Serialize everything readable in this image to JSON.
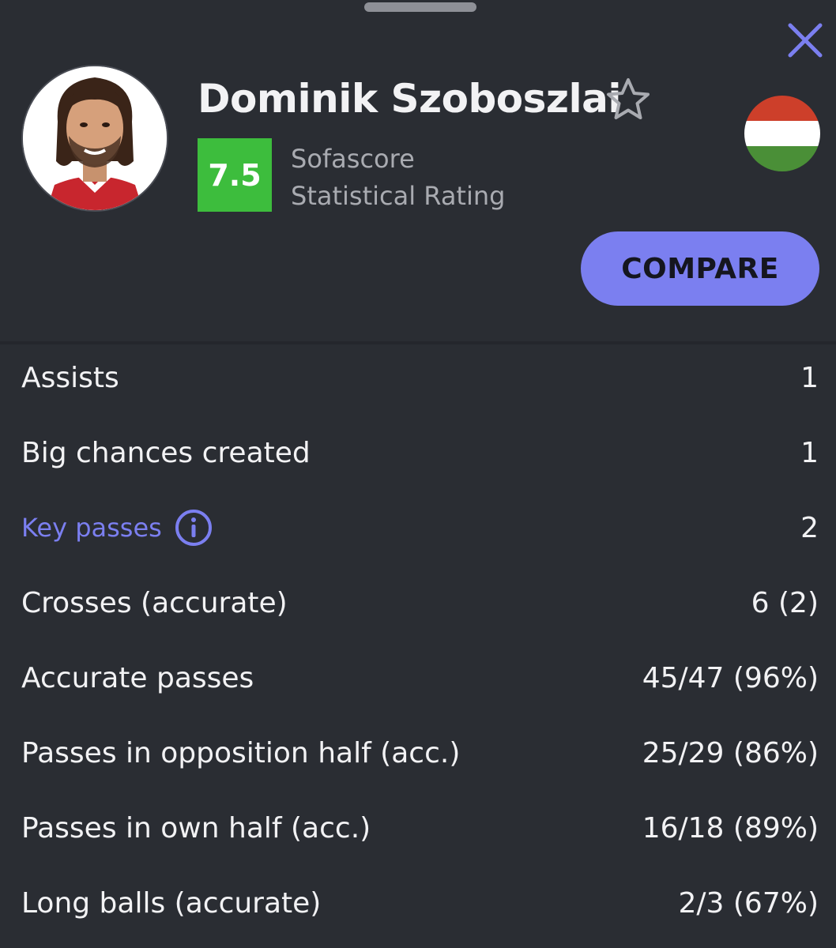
{
  "player": {
    "name": "Dominik Szoboszlai",
    "rating": "7.5",
    "rating_caption_line1": "Sofascore",
    "rating_caption_line2": "Statistical Rating",
    "photo": "player-photo",
    "flag": "hungary-flag"
  },
  "actions": {
    "compare_label": "COMPARE",
    "close_icon": "close-icon",
    "favorite_icon": "star-icon"
  },
  "colors": {
    "background": "#2a2d33",
    "accent": "#7b7ff0",
    "rating_green": "#3dbd3d",
    "flag_red": "#cd3f2a",
    "flag_white": "#ffffff",
    "flag_green": "#4a8f37"
  },
  "stats": [
    {
      "label": "Assists",
      "value": "1"
    },
    {
      "label": "Big chances created",
      "value": "1"
    },
    {
      "label": "Key passes",
      "value": "2",
      "link": true,
      "icon": "info-icon"
    },
    {
      "label": "Crosses (accurate)",
      "value": "6 (2)"
    },
    {
      "label": "Accurate passes",
      "value": "45/47 (96%)"
    },
    {
      "label": "Passes in opposition half (acc.)",
      "value": "25/29 (86%)"
    },
    {
      "label": "Passes in own half (acc.)",
      "value": "16/18 (89%)"
    },
    {
      "label": "Long balls (accurate)",
      "value": "2/3 (67%)"
    }
  ]
}
